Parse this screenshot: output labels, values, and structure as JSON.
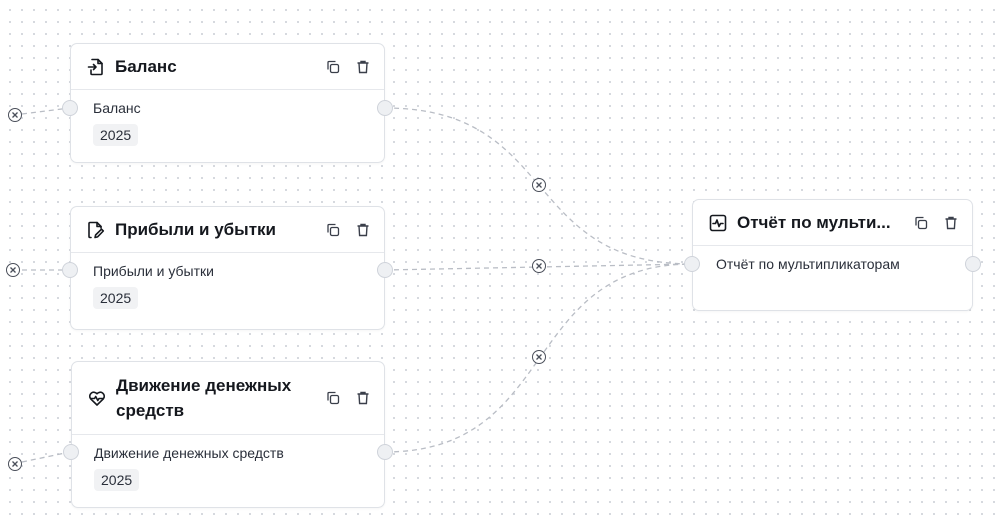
{
  "nodes": {
    "balance": {
      "title": "Баланс",
      "label": "Баланс",
      "year": "2025"
    },
    "pnl": {
      "title": "Прибыли и убытки",
      "label": "Прибыли и убытки",
      "year": "2025"
    },
    "cashflow": {
      "title": "Движение денежных средств",
      "label": "Движение денежных средств",
      "year": "2025"
    },
    "multiples": {
      "title": "Отчёт по мульти...",
      "label": "Отчёт по мультипликаторам"
    }
  },
  "icons": {
    "balance": "file-import-icon",
    "pnl": "file-edit-icon",
    "cashflow": "heart-pulse-icon",
    "multiples": "activity-square-icon",
    "copy": "copy-icon",
    "delete": "trash-icon",
    "edge_delete": "x-circle-icon"
  },
  "colors": {
    "edge": "#b9bdc5",
    "accent_text": "#15181e"
  }
}
